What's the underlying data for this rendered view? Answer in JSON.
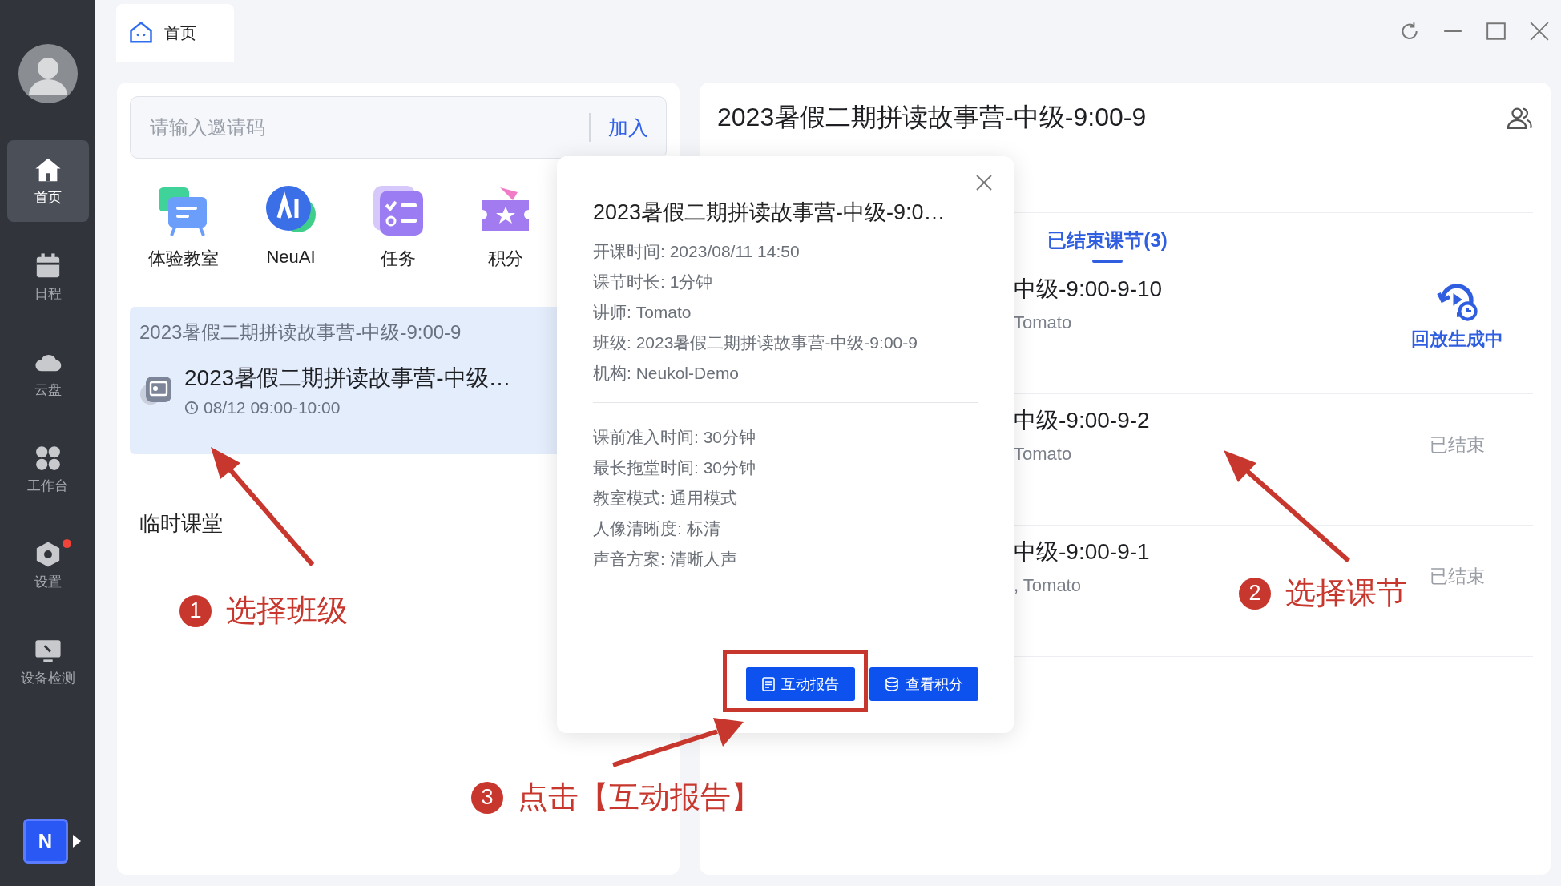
{
  "sidebar": {
    "items": [
      {
        "label": "首页",
        "kind": "home",
        "selected": true,
        "badge": false
      },
      {
        "label": "日程",
        "kind": "calendar",
        "selected": false,
        "badge": false
      },
      {
        "label": "云盘",
        "kind": "cloud",
        "selected": false,
        "badge": false
      },
      {
        "label": "工作台",
        "kind": "apps",
        "selected": false,
        "badge": false
      },
      {
        "label": "设置",
        "kind": "settings",
        "selected": false,
        "badge": true
      },
      {
        "label": "设备检测",
        "kind": "monitor",
        "selected": false,
        "badge": false
      }
    ],
    "brand": "N"
  },
  "top_tab": {
    "label": "首页"
  },
  "left_panel": {
    "invite": {
      "placeholder": "请输入邀请码",
      "button": "加入"
    },
    "shortcuts": [
      {
        "label": "体验教室",
        "kind": "classroom"
      },
      {
        "label": "NeuAI",
        "kind": "ai"
      },
      {
        "label": "任务",
        "kind": "task"
      },
      {
        "label": "积分",
        "kind": "points"
      }
    ],
    "class_card": {
      "group": "2023暑假二期拼读故事营-中级-9:00-9",
      "title": "2023暑假二期拼读故事营-中级…",
      "time": "08/12 09:00-10:00",
      "selected": true
    },
    "section": "临时课堂"
  },
  "right_panel": {
    "title": "2023暑假二期拼读故事营-中级-9:00-9",
    "tab": {
      "label": "已结束课节(3)",
      "selected": true
    },
    "lessons": [
      {
        "title": "中级-9:00-9-10",
        "subtitle": "Tomato",
        "status": "回放生成中",
        "kind": "replay"
      },
      {
        "title": "中级-9:00-9-2",
        "subtitle": "Tomato",
        "status": "已结束",
        "kind": "ended"
      },
      {
        "title": "中级-9:00-9-1",
        "subtitle": ", Tomato",
        "status": "已结束",
        "kind": "ended"
      }
    ]
  },
  "dialog": {
    "title": "2023暑假二期拼读故事营-中级-9:0…",
    "details": [
      "开课时间: 2023/08/11 14:50",
      "课节时长: 1分钟",
      "讲师: Tomato",
      "班级: 2023暑假二期拼读故事营-中级-9:00-9",
      "机构: Neukol-Demo"
    ],
    "settings": [
      "课前准入时间: 30分钟",
      "最长拖堂时间: 30分钟",
      "教室模式: 通用模式",
      "人像清晰度: 标清",
      "声音方案: 清晰人声"
    ],
    "buttons": [
      {
        "label": "互动报告",
        "kind": "report"
      },
      {
        "label": "查看积分",
        "kind": "points"
      }
    ]
  },
  "annotations": [
    {
      "number": "1",
      "text": "选择班级"
    },
    {
      "number": "2",
      "text": "选择课节"
    },
    {
      "number": "3",
      "text": "点击【互动报告】"
    }
  ]
}
